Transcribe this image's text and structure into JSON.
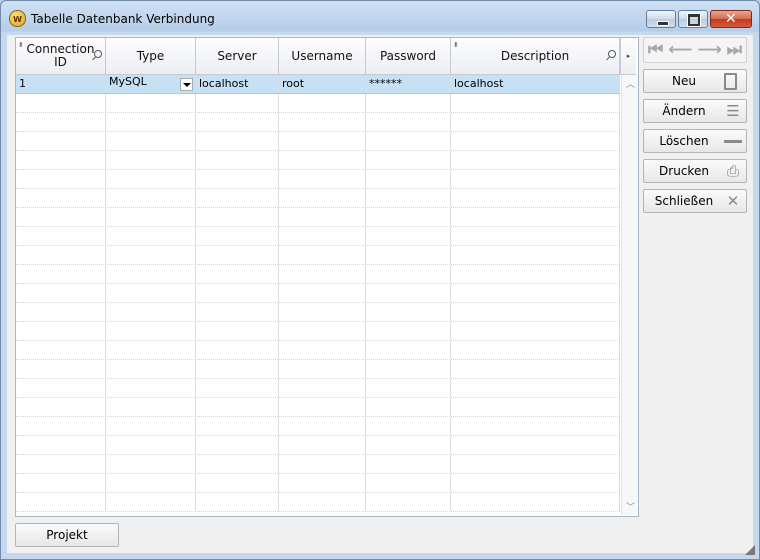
{
  "window": {
    "title": "Tabelle Datenbank Verbindung",
    "icon_name": "app-logo-icon",
    "icon_text": "W"
  },
  "grid": {
    "columns": [
      {
        "label": "Connection ID",
        "filter": true
      },
      {
        "label": "Type",
        "filter": false
      },
      {
        "label": "Server",
        "filter": false
      },
      {
        "label": "Username",
        "filter": false
      },
      {
        "label": "Password",
        "filter": false
      },
      {
        "label": "Description",
        "filter": true
      }
    ],
    "rows": [
      [
        "1",
        "MySQL",
        "localhost",
        "root",
        "******",
        "localhost"
      ]
    ],
    "selected_row": 0
  },
  "sidebar": {
    "buttons": [
      {
        "label": "Neu",
        "icon": "new-document-icon"
      },
      {
        "label": "Ändern",
        "icon": "edit-list-icon"
      },
      {
        "label": "Löschen",
        "icon": "minus-icon"
      },
      {
        "label": "Drucken",
        "icon": "printer-icon"
      },
      {
        "label": "Schließen",
        "icon": "close-x-icon"
      }
    ]
  },
  "footer": {
    "projekt_label": "Projekt"
  },
  "colors": {
    "selection": "#c6e1f3",
    "titlebar": "#b6cde8"
  }
}
